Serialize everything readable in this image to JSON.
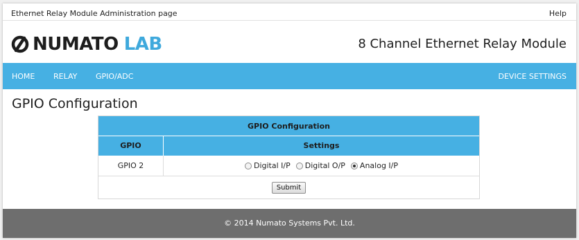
{
  "topbar": {
    "title": "Ethernet Relay Module Administration page",
    "help": "Help"
  },
  "brand": {
    "logo_word1": "NUMATO",
    "logo_word2": "LAB",
    "product": "8 Channel Ethernet Relay Module",
    "colors": {
      "accent": "#46b0e3",
      "logo_blue": "#3fa9dc"
    }
  },
  "nav": {
    "home": "HOME",
    "relay": "RELAY",
    "gpio": "GPIO/ADC",
    "device_settings": "DEVICE SETTINGS"
  },
  "main": {
    "title": "GPIO Configuration",
    "table": {
      "caption": "GPIO Configuration",
      "col_gpio": "GPIO",
      "col_settings": "Settings",
      "rows": [
        {
          "gpio": "GPIO 2",
          "options": [
            {
              "label": "Digital I/P",
              "selected": false
            },
            {
              "label": "Digital O/P",
              "selected": false
            },
            {
              "label": "Analog I/P",
              "selected": true
            }
          ]
        }
      ],
      "submit": "Submit"
    }
  },
  "footer": {
    "text": "© 2014 Numato Systems Pvt. Ltd."
  }
}
